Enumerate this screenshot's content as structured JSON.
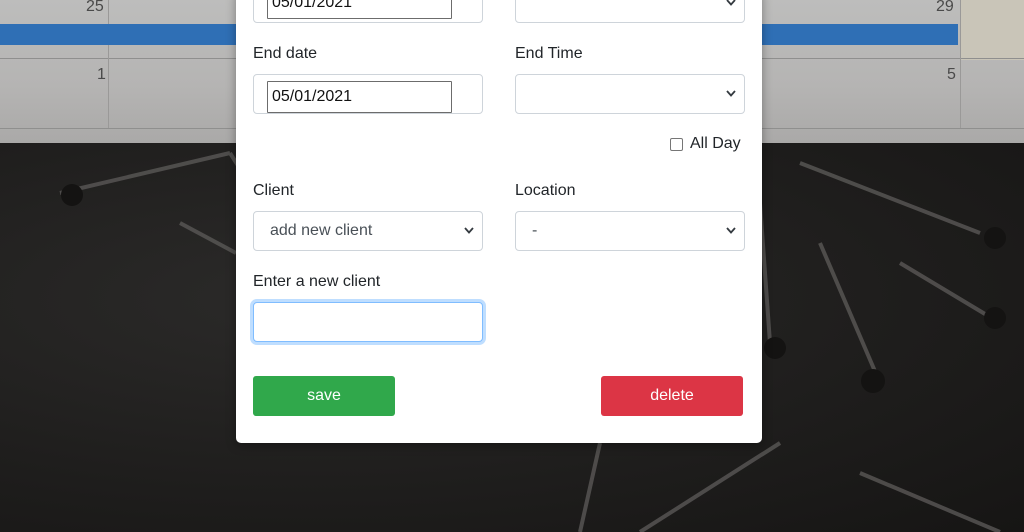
{
  "calendar": {
    "day_numbers": {
      "row1_left": "25",
      "row1_right": "29",
      "row2_left": "1",
      "row2_right": "5"
    },
    "event_color": "#2f6fb5"
  },
  "modal": {
    "start_date": {
      "value": "05/01/2021"
    },
    "end_date": {
      "label": "End date",
      "value": "05/01/2021"
    },
    "end_time": {
      "label": "End Time",
      "value": ""
    },
    "all_day": {
      "label": "All Day",
      "checked": false
    },
    "client": {
      "label": "Client",
      "value": "add new client"
    },
    "location": {
      "label": "Location",
      "value": "-"
    },
    "new_client": {
      "label": "Enter a new client",
      "value": ""
    },
    "buttons": {
      "save_label": "save",
      "delete_label": "delete",
      "save_color": "#30a84b",
      "delete_color": "#dc3545"
    },
    "icons": {
      "dropdown": "chevron-down-icon"
    }
  }
}
